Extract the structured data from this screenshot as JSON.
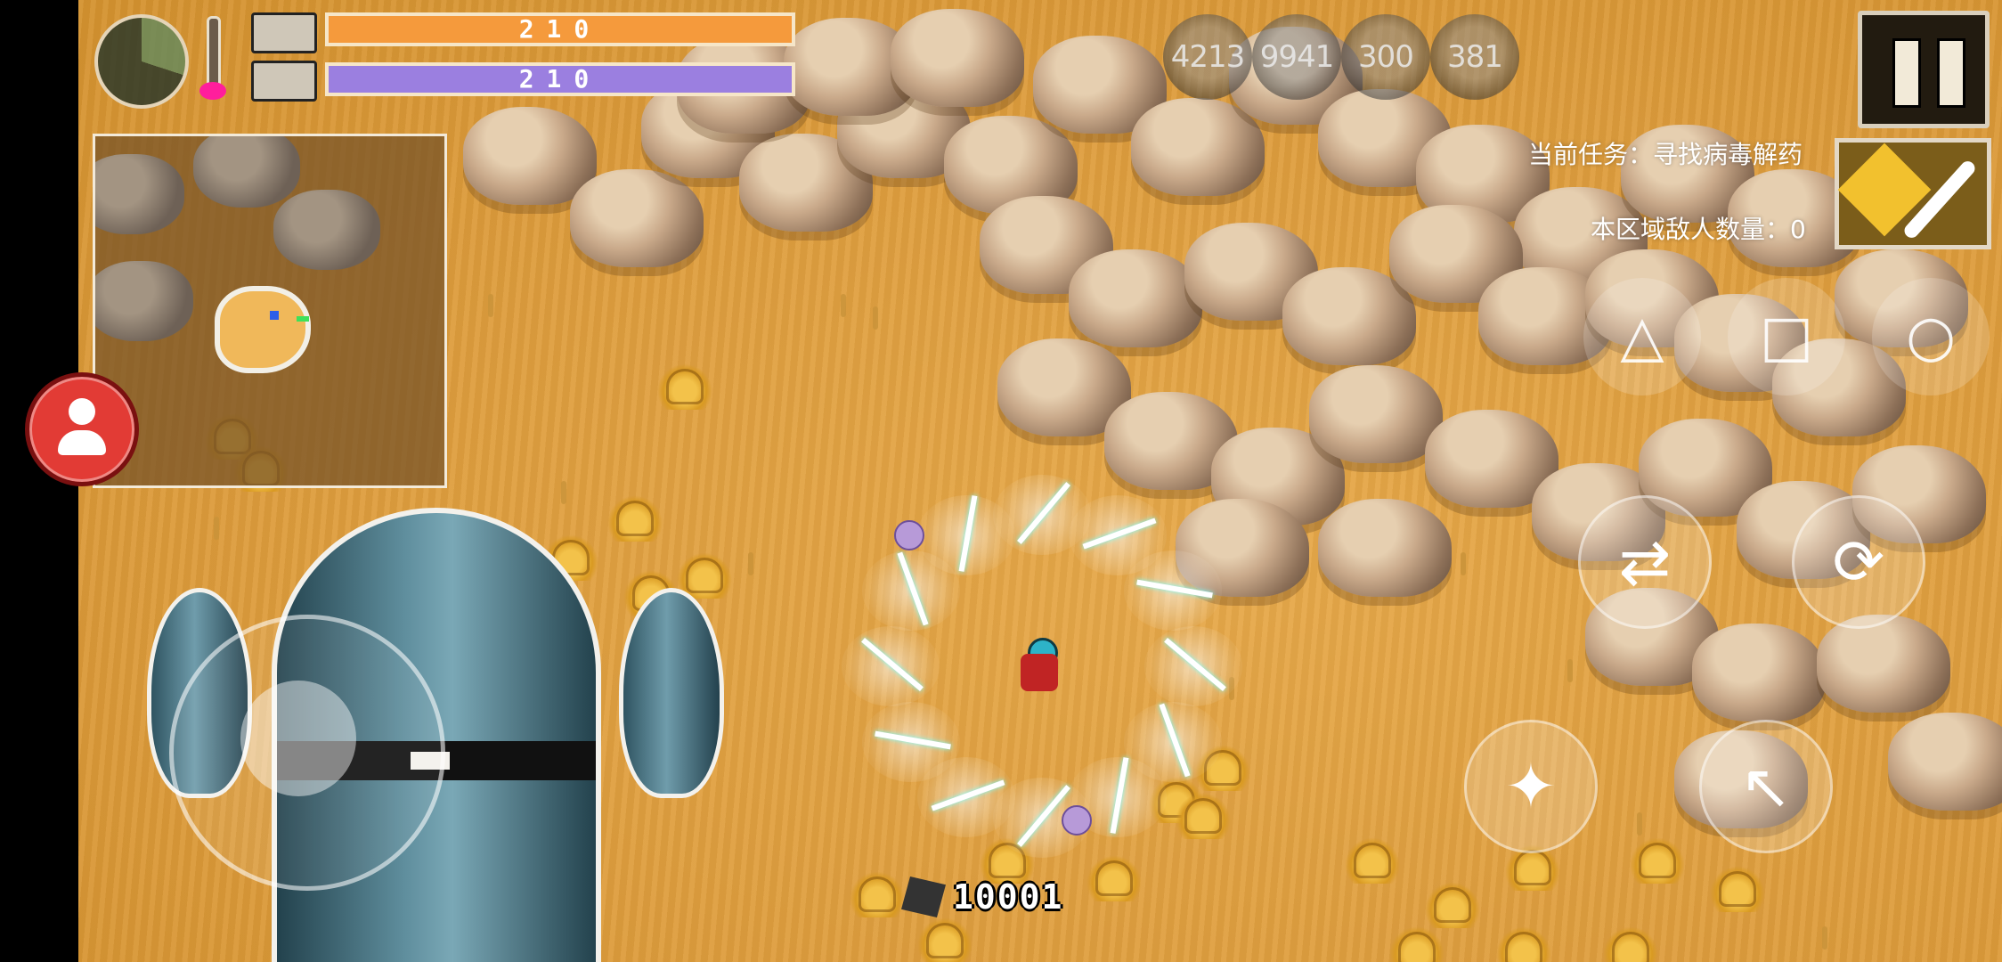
{
  "hud": {
    "hp": "210",
    "mp": "210",
    "resources": [
      "4213",
      "9941",
      "300",
      "381"
    ],
    "quest": "当前任务：寻找病毒解药",
    "enemy_count": "本区域敌人数量：0",
    "gem_count": "10001"
  },
  "icons": {
    "compass": "compass-icon",
    "thermometer": "thermometer-icon",
    "pause": "pause-icon",
    "settings": "heart-wrench-icon",
    "profile": "user-icon",
    "triangle": "triangle-icon",
    "square": "square-icon",
    "circle": "circle-icon",
    "swap": "swap-weapon-icon",
    "dash": "dash-icon",
    "skill": "shuriken-icon",
    "attack": "attack-arrow-icon",
    "gem": "gem-icon"
  },
  "colors": {
    "hp_bar": "#f59a3c",
    "mp_bar": "#9b7fe0",
    "ground": "#e7a94a",
    "profile_button": "#e23b35",
    "thermometer_bulb": "#ff1e9c"
  }
}
